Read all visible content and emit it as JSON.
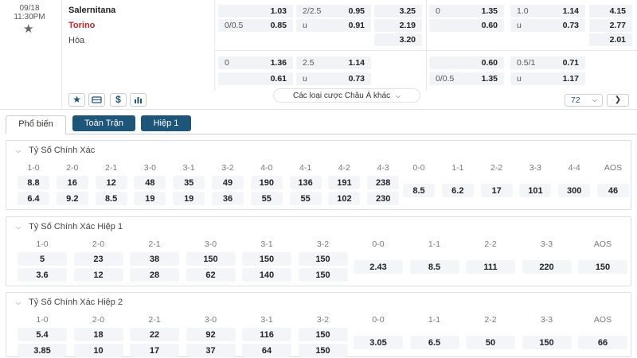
{
  "match": {
    "date": "09/18",
    "time": "11:30PM",
    "home": "Salernitana",
    "away": "Torino",
    "draw": "Hòa",
    "star_icon": "star-icon"
  },
  "odds_block1": {
    "row1": {
      "a_label": "",
      "a_val": "1.03",
      "b_label": "2/2.5",
      "b_val": "0.95",
      "x12": "3.25",
      "c_label": "0",
      "c_val": "1.35",
      "d_label": "1.0",
      "d_val": "1.14",
      "x12b": "4.15"
    },
    "row2": {
      "a_label": "0/0.5",
      "a_val": "0.85",
      "b_label": "u",
      "b_val": "0.91",
      "x12": "2.19",
      "c_label": "",
      "c_val": "0.60",
      "d_label": "u",
      "d_val": "0.73",
      "x12b": "2.77"
    },
    "row3": {
      "x12": "3.20",
      "x12b": "2.01"
    }
  },
  "odds_block2": {
    "row1": {
      "a_label": "0",
      "a_val": "1.36",
      "b_label": "2.5",
      "b_val": "1.14",
      "c_label": "",
      "c_val": "0.60",
      "d_label": "0.5/1",
      "d_val": "0.71"
    },
    "row2": {
      "a_label": "",
      "a_val": "0.61",
      "b_label": "u",
      "b_val": "0.73",
      "c_label": "0/0.5",
      "c_val": "1.35",
      "d_label": "u",
      "d_val": "1.17"
    }
  },
  "toolbar": {
    "more_label": "Các loại cược Châu Á khác",
    "market_count": "72",
    "next_icon": "chevron-right-icon"
  },
  "tabs": [
    "Phổ biến",
    "Toàn Trận",
    "Hiệp 1"
  ],
  "panels": [
    {
      "title": "Tỷ Số Chính Xác",
      "pairs": [
        {
          "score": "1-0",
          "top": "8.8",
          "bottom": "6.4"
        },
        {
          "score": "2-0",
          "top": "16",
          "bottom": "9.2"
        },
        {
          "score": "2-1",
          "top": "12",
          "bottom": "8.5"
        },
        {
          "score": "3-0",
          "top": "48",
          "bottom": "19"
        },
        {
          "score": "3-1",
          "top": "35",
          "bottom": "19"
        },
        {
          "score": "3-2",
          "top": "49",
          "bottom": "36"
        },
        {
          "score": "4-0",
          "top": "190",
          "bottom": "55"
        },
        {
          "score": "4-1",
          "top": "136",
          "bottom": "55"
        },
        {
          "score": "4-2",
          "top": "191",
          "bottom": "102"
        },
        {
          "score": "4-3",
          "top": "238",
          "bottom": "230"
        }
      ],
      "singles": [
        {
          "score": "0-0",
          "val": "8.5"
        },
        {
          "score": "1-1",
          "val": "6.2"
        },
        {
          "score": "2-2",
          "val": "17"
        },
        {
          "score": "3-3",
          "val": "101"
        },
        {
          "score": "4-4",
          "val": "300"
        },
        {
          "score": "AOS",
          "val": "46"
        }
      ]
    },
    {
      "title": "Tỷ Số Chính Xác Hiệp 1",
      "pairs": [
        {
          "score": "1-0",
          "top": "5",
          "bottom": "3.6"
        },
        {
          "score": "2-0",
          "top": "23",
          "bottom": "12"
        },
        {
          "score": "2-1",
          "top": "38",
          "bottom": "28"
        },
        {
          "score": "3-0",
          "top": "150",
          "bottom": "62"
        },
        {
          "score": "3-1",
          "top": "150",
          "bottom": "140"
        },
        {
          "score": "3-2",
          "top": "150",
          "bottom": "150"
        }
      ],
      "singles": [
        {
          "score": "0-0",
          "val": "2.43"
        },
        {
          "score": "1-1",
          "val": "8.5"
        },
        {
          "score": "2-2",
          "val": "111"
        },
        {
          "score": "3-3",
          "val": "220"
        },
        {
          "score": "AOS",
          "val": "150"
        }
      ]
    },
    {
      "title": "Tỷ Số Chính Xác Hiệp 2",
      "pairs": [
        {
          "score": "1-0",
          "top": "5.4",
          "bottom": "3.85"
        },
        {
          "score": "2-0",
          "top": "18",
          "bottom": "10"
        },
        {
          "score": "2-1",
          "top": "22",
          "bottom": "17"
        },
        {
          "score": "3-0",
          "top": "92",
          "bottom": "37"
        },
        {
          "score": "3-1",
          "top": "116",
          "bottom": "64"
        },
        {
          "score": "3-2",
          "top": "150",
          "bottom": "150"
        }
      ],
      "singles": [
        {
          "score": "0-0",
          "val": "3.05"
        },
        {
          "score": "1-1",
          "val": "6.5"
        },
        {
          "score": "2-2",
          "val": "50"
        },
        {
          "score": "3-3",
          "val": "150"
        },
        {
          "score": "AOS",
          "val": "66"
        }
      ]
    }
  ]
}
